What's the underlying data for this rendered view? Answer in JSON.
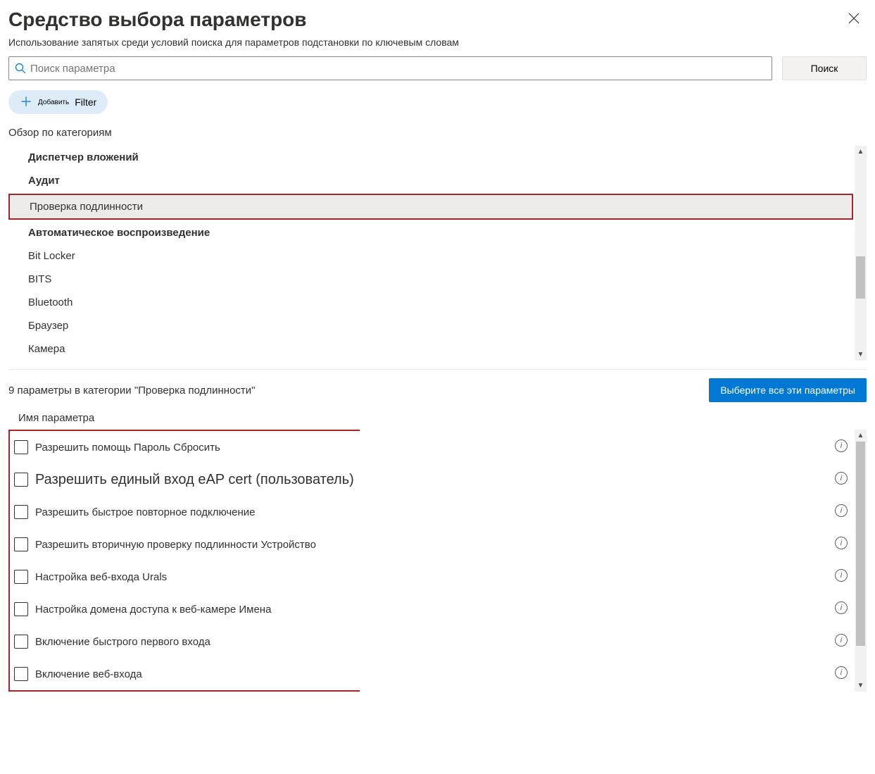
{
  "header": {
    "title": "Средство выбора параметров",
    "subtitle": "Использование запятых среди условий поиска для параметров подстановки по ключевым словам"
  },
  "search": {
    "placeholder": "Поиск параметра",
    "button": "Поиск"
  },
  "addFilter": {
    "prefix": "Добавить",
    "label": "Filter"
  },
  "browse_label": "Обзор по категориям",
  "categories": [
    {
      "label": "Диспетчер вложений",
      "bold": true,
      "selected": false
    },
    {
      "label": "Аудит",
      "bold": true,
      "selected": false
    },
    {
      "label": "Проверка подлинности",
      "bold": false,
      "selected": true
    },
    {
      "label": "Автоматическое воспроизведение",
      "bold": true,
      "selected": false
    },
    {
      "label": "Bit Locker",
      "bold": false,
      "selected": false
    },
    {
      "label": "BITS",
      "bold": false,
      "selected": false
    },
    {
      "label": "Bluetooth",
      "bold": false,
      "selected": false
    },
    {
      "label": "Браузер",
      "bold": false,
      "selected": false
    },
    {
      "label": "Камера",
      "bold": false,
      "selected": false
    }
  ],
  "results": {
    "count": "9",
    "text": "параметры в категории \"Проверка подлинности\"",
    "select_all": "Выберите все эти параметры",
    "column_header": "Имя параметра"
  },
  "settings": [
    {
      "label": "Разрешить помощь Пароль   Сбросить"
    },
    {
      "label": "Разрешить единый вход eAP cert (пользователь)"
    },
    {
      "label": "Разрешить быстрое повторное подключение"
    },
    {
      "label": "Разрешить вторичную проверку подлинности  Устройство"
    },
    {
      "label": "Настройка веб-входа                  Urals"
    },
    {
      "label": "Настройка домена доступа к веб-камере  Имена"
    },
    {
      "label": "Включение быстрого первого входа"
    },
    {
      "label": "Включение веб-входа"
    }
  ]
}
